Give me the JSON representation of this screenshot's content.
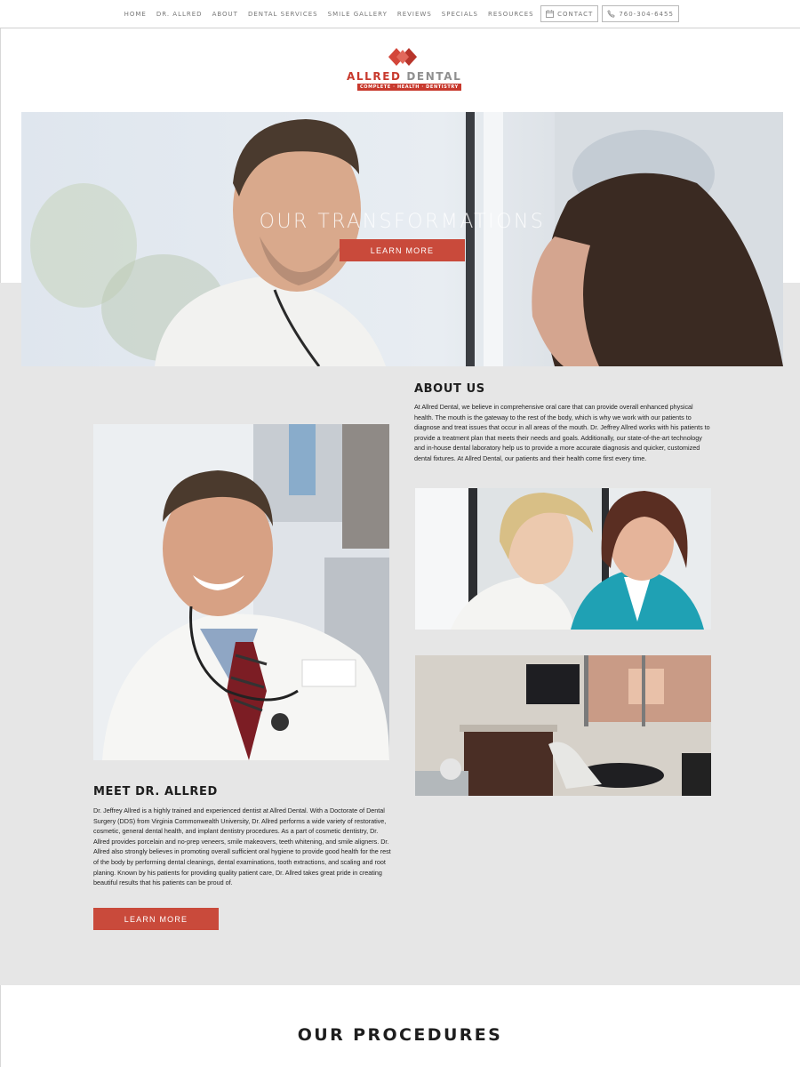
{
  "nav": {
    "items": [
      "HOME",
      "DR. ALLRED",
      "ABOUT",
      "DENTAL SERVICES",
      "SMILE GALLERY",
      "REVIEWS",
      "SPECIALS",
      "RESOURCES"
    ],
    "contact_label": "CONTACT",
    "phone_label": "760-304-6455"
  },
  "logo": {
    "brand_part1": "ALLRED",
    "brand_part2": "DENTAL",
    "tagline": "COMPLETE · HEALTH · DENTISTRY"
  },
  "hero": {
    "title": "OUR TRANSFORMATIONS",
    "button_label": "LEARN MORE"
  },
  "about": {
    "heading": "ABOUT US",
    "body": "At Allred Dental, we believe in comprehensive oral care that can provide overall enhanced physical health. The mouth is the gateway to the rest of the body, which is why we work with our patients to diagnose and treat issues that occur in all areas of the mouth. Dr. Jeffrey Allred works with his patients to provide a treatment plan that meets their needs and goals. Additionally, our state-of-the-art technology and in-house dental laboratory help us to provide a more accurate diagnosis and quicker, customized dental fixtures. At Allred Dental, our patients and their health come first every time."
  },
  "meet": {
    "heading": "MEET DR. ALLRED",
    "body": "Dr. Jeffrey Allred is a highly trained and experienced dentist at Allred Dental. With a Doctorate of Dental Surgery (DDS) from Virginia Commonwealth University, Dr. Allred performs a wide variety of restorative, cosmetic, general dental health, and implant dentistry procedures. As a part of cosmetic dentistry, Dr. Allred provides porcelain and no-prep veneers, smile makeovers, teeth whitening, and smile aligners. Dr. Allred also strongly believes in promoting overall sufficient oral hygiene to provide good health for the rest of the body by performing dental cleanings, dental examinations, tooth extractions, and scaling and root planing. Known by his patients for providing quality patient care, Dr. Allred takes great pride in creating beautiful results that his patients can be proud of.",
    "button_label": "LEARN MORE"
  },
  "procedures": {
    "heading": "OUR PROCEDURES"
  },
  "colors": {
    "accent": "#c94a3b",
    "grey_band": "#e6e6e6"
  }
}
